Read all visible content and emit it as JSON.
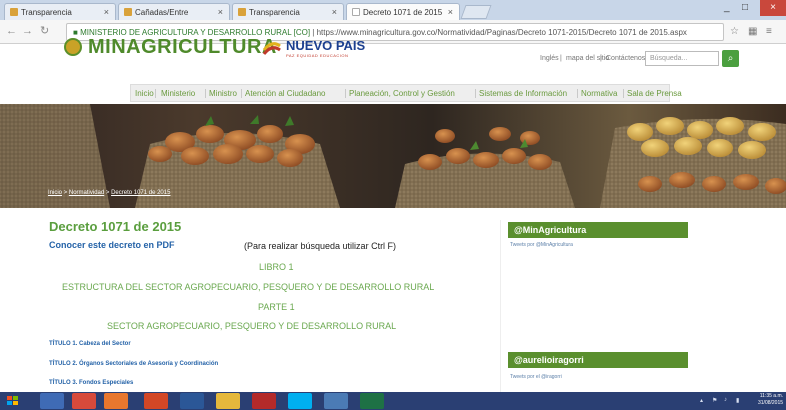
{
  "browser": {
    "tabs": [
      {
        "label": "Transparencia"
      },
      {
        "label": "Cañadas/Entre"
      },
      {
        "label": "Transparencia"
      },
      {
        "label": "Decreto 1071 de 2015"
      }
    ],
    "window_controls": {
      "minimize": "_",
      "maximize": "□",
      "close": "×"
    },
    "url_org": "MINISTERIO DE AGRICULTURA Y DESARROLLO RURAL [CO]",
    "url_path": "https://www.minagricultura.gov.co/Normatividad/Paginas/Decreto 1071-2015/Decreto 1071 de 2015.aspx"
  },
  "header": {
    "logo": "MINAGRICULTURA",
    "partner_logo": "NUEVO PAIS",
    "partner_tagline": "PAZ EQUIDAD EDUCACION",
    "utility_links": [
      "Inglés",
      "mapa del sitio",
      "Contáctenos"
    ],
    "search_placeholder": "Búsqueda...",
    "search_icon": "magnifier-icon"
  },
  "nav": {
    "items": [
      "Inicio",
      "Ministerio",
      "Ministro",
      "Atención al Ciudadano",
      "Planeación, Control y Gestión",
      "Sistemas de Información",
      "Normativa",
      "Sala de Prensa"
    ]
  },
  "breadcrumb": {
    "items": [
      "Inicio",
      "Normatividad",
      "Decreto 1071 de 2015"
    ]
  },
  "content": {
    "title": "Decreto 1071 de 2015",
    "pdf_link": "Conocer este decreto en PDF",
    "search_hint": "(Para realizar búsqueda utilizar Ctrl F)",
    "libro": "LIBRO 1",
    "libro_title": "ESTRUCTURA DEL SECTOR AGROPECUARIO, PESQUERO Y DE DESARROLLO RURAL",
    "parte": "PARTE 1",
    "parte_title": "SECTOR AGROPECUARIO, PESQUERO Y DE DESARROLLO RURAL",
    "titulos": [
      "TÍTULO 1. Cabeza del Sector",
      "TÍTULO 2. Órganos Sectoriales de Asesoría y Coordinación",
      "TÍTULO 3. Fondos Especiales"
    ]
  },
  "sidebar": {
    "widgets": [
      {
        "title": "@MinAgricultura",
        "sub": "Tweets por @MinAgricultura"
      },
      {
        "title": "@aurelioiragorri",
        "sub": "Tweets por el @iragorri"
      }
    ]
  },
  "taskbar": {
    "clock_time": "11:35 a.m.",
    "clock_date": "31/08/2015"
  },
  "colors": {
    "brand_green": "#5a8f2e",
    "link_blue": "#2563a8",
    "taskbar": "#2a3f73"
  }
}
